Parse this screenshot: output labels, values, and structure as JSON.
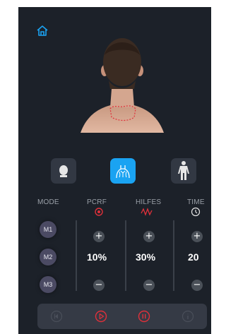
{
  "colors": {
    "background": "#1c2129",
    "accent": "#1aa3f2",
    "alert_red": "#e0303a",
    "panel": "#323843"
  },
  "icons": {
    "home": "home-icon",
    "face_view": "face-view-icon",
    "back_view": "back-view-icon",
    "body_view": "full-body-icon",
    "pcrf": "pcrf-icon",
    "hilfes": "wave-icon",
    "time": "clock-icon",
    "prev": "previous-icon",
    "play": "play-icon",
    "pause": "pause-icon",
    "info": "info-icon"
  },
  "views": {
    "selected": "back"
  },
  "columns": {
    "mode": "MODE",
    "pcrf": "PCRF",
    "hilfes": "HILFES",
    "time": "TIME"
  },
  "modes": [
    "M1",
    "M2",
    "M3"
  ],
  "values": {
    "pcrf": "10%",
    "hilfes": "30%",
    "time": "20"
  },
  "controls": {
    "plus": "+",
    "minus": "−"
  }
}
